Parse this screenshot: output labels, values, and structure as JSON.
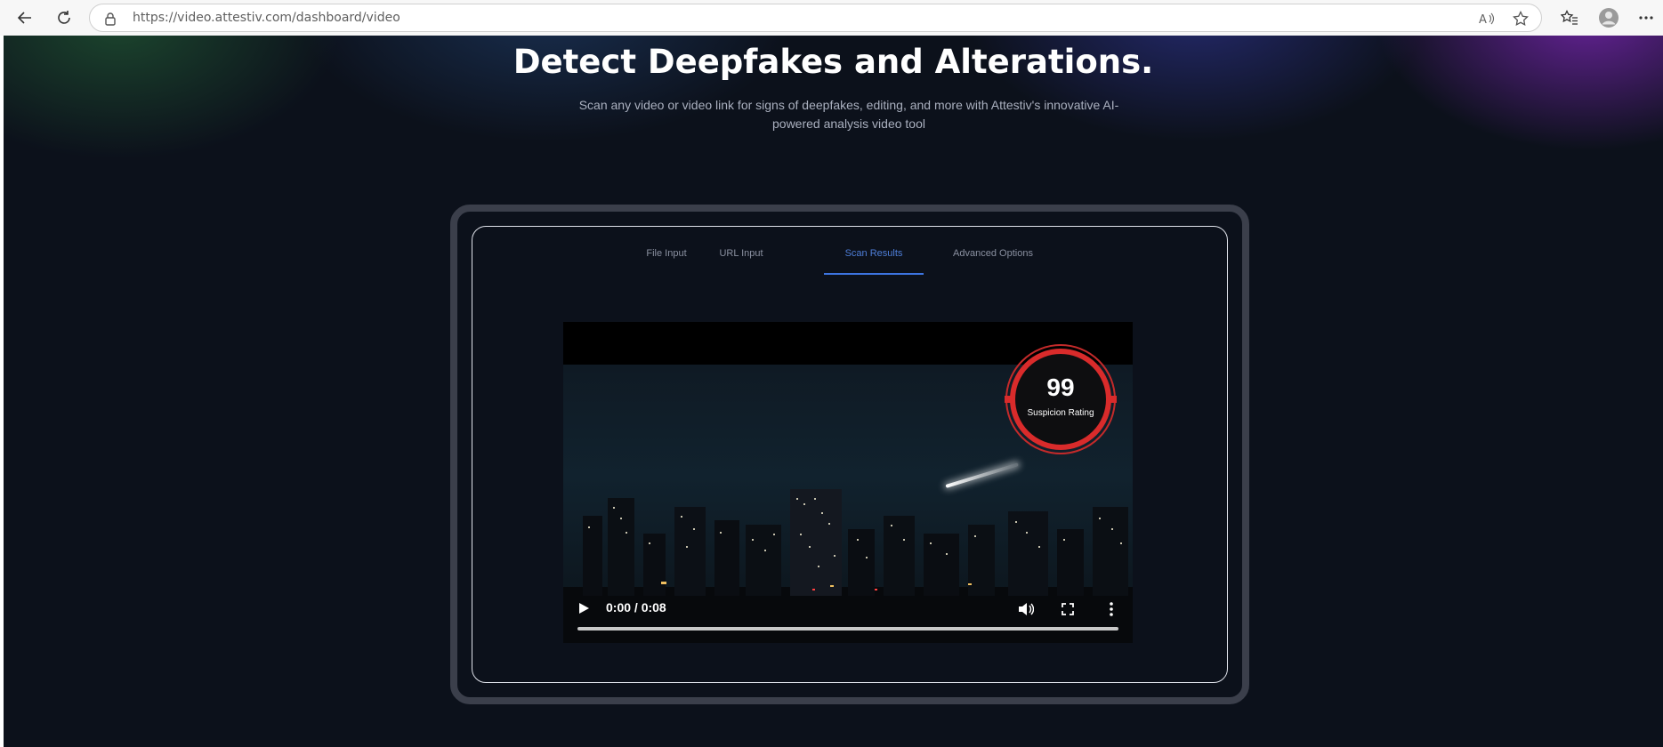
{
  "browser": {
    "url": "https://video.attestiv.com/dashboard/video",
    "icons": [
      "back-arrow-icon",
      "refresh-icon",
      "lock-icon",
      "read-aloud-icon",
      "favorite-star-icon",
      "favorites-icon",
      "profile-icon",
      "more-options-icon"
    ]
  },
  "hero": {
    "title": "Detect Deepfakes and Alterations.",
    "subtitle": "Scan any video or video link for signs of deepfakes, editing, and more with Attestiv's innovative AI-powered analysis video tool"
  },
  "tabs": [
    {
      "label": "File Input",
      "active": false
    },
    {
      "label": "URL Input",
      "active": false
    },
    {
      "label": "Scan Results",
      "active": true
    },
    {
      "label": "Advanced Options",
      "active": false
    }
  ],
  "video": {
    "suspicion": {
      "score": "99",
      "label": "Suspicion Rating"
    },
    "time": "0:00 / 0:08",
    "progress": 0,
    "controls": [
      "play-icon",
      "volume-icon",
      "fullscreen-icon",
      "more-vertical-icon"
    ]
  },
  "colors": {
    "page_bg": "#0c111b",
    "accent": "#4e7ed8",
    "rating_ring": "#d92b2b"
  }
}
